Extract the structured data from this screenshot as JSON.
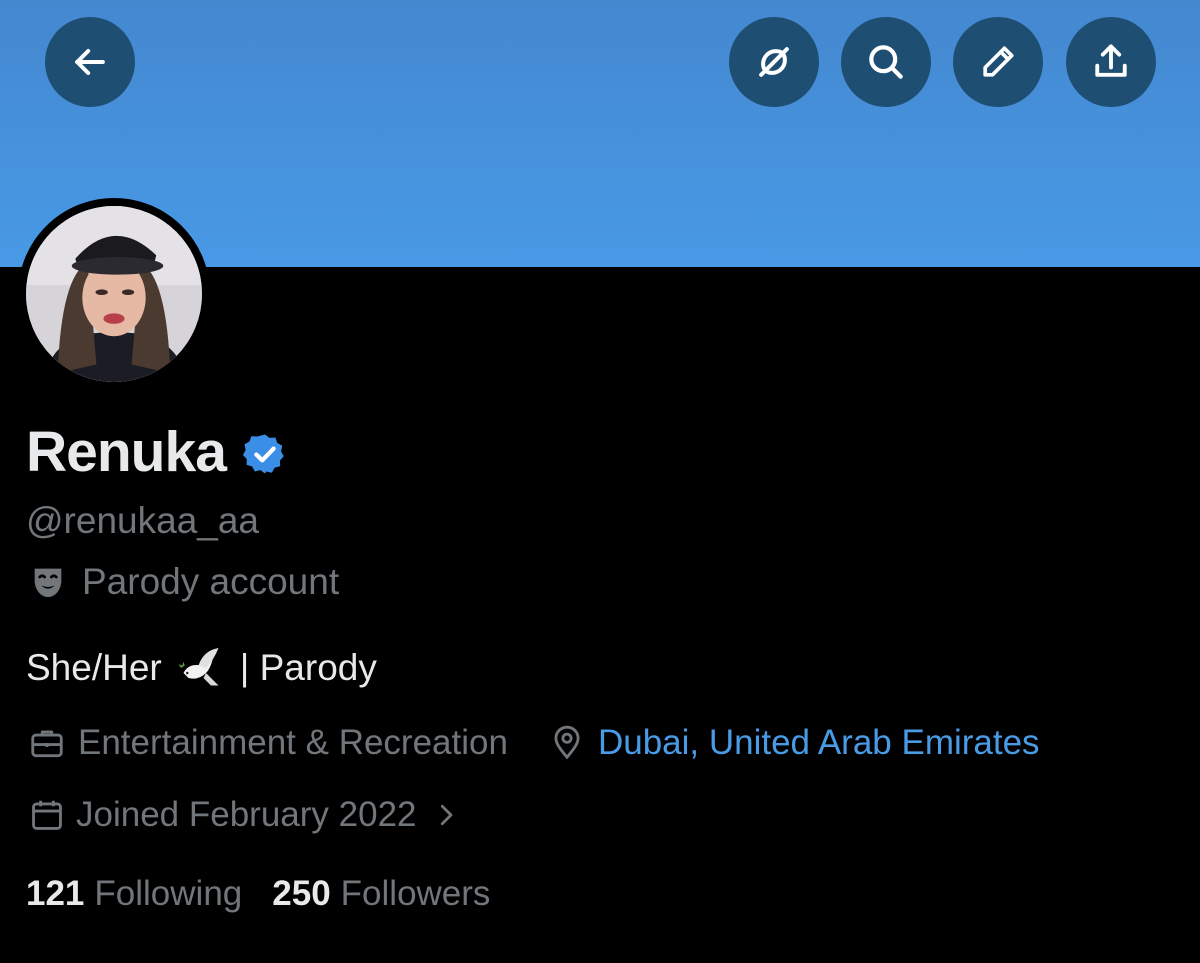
{
  "colors": {
    "banner": "#4899e6",
    "background": "#000000",
    "button_bg": "#1f4e73",
    "primary_text": "#e7e9ea",
    "secondary_text": "#71767b",
    "link": "#4a9be6",
    "verified": "#3a8ee6"
  },
  "header": {
    "buttons": [
      {
        "name": "back",
        "icon": "arrow-left-icon"
      },
      {
        "name": "grok",
        "icon": "grok-slash-circle-icon"
      },
      {
        "name": "search",
        "icon": "search-icon"
      },
      {
        "name": "edit",
        "icon": "pencil-icon"
      },
      {
        "name": "share",
        "icon": "share-upload-icon"
      }
    ]
  },
  "profile": {
    "display_name": "Renuka",
    "verified_icon": "verified-badge-icon",
    "handle": "@renukaa_aa",
    "parody_label": "Parody account",
    "parody_icon": "theater-mask-icon",
    "bio_start": "She/Her",
    "bio_emoji": "dove-icon",
    "bio_end": "| Parody",
    "category": "Entertainment & Recreation",
    "category_icon": "briefcase-icon",
    "location": "Dubai, United Arab Emirates",
    "location_icon": "map-pin-icon",
    "joined": "Joined February 2022",
    "joined_icon": "calendar-icon",
    "following_count": "121",
    "following_label": "Following",
    "followers_count": "250",
    "followers_label": "Followers"
  }
}
